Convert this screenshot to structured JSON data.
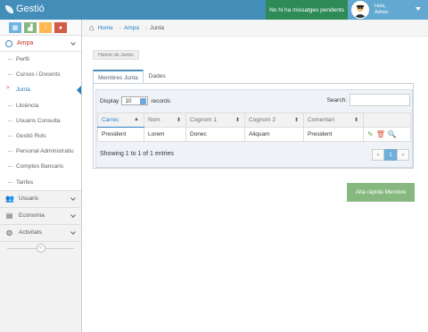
{
  "header": {
    "brand": "Gestió",
    "messages": "No hi ha missatges pendents",
    "user_greeting": "Hola,",
    "user_name": "Admin"
  },
  "colors": {
    "topbar": "#438eb9",
    "messages_bg": "#2e8a57",
    "user_bg": "#62a8d1",
    "shortcut_1": "#6fb3e0",
    "shortcut_2": "#87b87f",
    "shortcut_3": "#ffb752",
    "shortcut_4": "#d15b47",
    "add_button": "#87b87f",
    "accent": "#2b7dbc"
  },
  "shortcuts": [
    {
      "icon": "calendar-icon"
    },
    {
      "icon": "bar-chart-icon"
    },
    {
      "icon": "info-icon"
    },
    {
      "icon": "comment-icon"
    }
  ],
  "sidebar": {
    "top": {
      "label": "Ampa",
      "expanded": true
    },
    "sub_items": [
      "Perfil",
      "Cursos i Docents",
      "Junta",
      "Llicència",
      "Usuaris Consulta",
      "Gestió Rols",
      "Personal Administratiu",
      "Comptes Bancaris",
      "Tarifes"
    ],
    "active_sub": "Junta",
    "items": [
      {
        "label": "Usuaris",
        "icon": "users-icon"
      },
      {
        "label": "Economia",
        "icon": "chart-icon"
      },
      {
        "label": "Activitats",
        "icon": "globe-icon"
      }
    ]
  },
  "breadcrumb": {
    "home": "Home",
    "items": [
      "Ampa",
      "Junta"
    ]
  },
  "history_button": "Historic de Juntes",
  "tabs": [
    {
      "label": "Membres Junta",
      "active": true
    },
    {
      "label": "Dades",
      "active": false
    }
  ],
  "table_controls": {
    "display_label": "Display",
    "display_value": "10",
    "records_label": "records",
    "search_label": "Search:"
  },
  "table": {
    "columns": [
      "Carrec",
      "Nom",
      "Cognom 1",
      "Cognom 2",
      "Comentari",
      ""
    ],
    "rows": [
      [
        "President",
        "Lorem",
        "Donec",
        "Aliquam",
        "President"
      ]
    ]
  },
  "info": "Showing 1 to 1 of 1 entries",
  "pagination": {
    "prev": "«",
    "current": "1",
    "next": "»"
  },
  "add_button": "Alta ràpida Membre"
}
